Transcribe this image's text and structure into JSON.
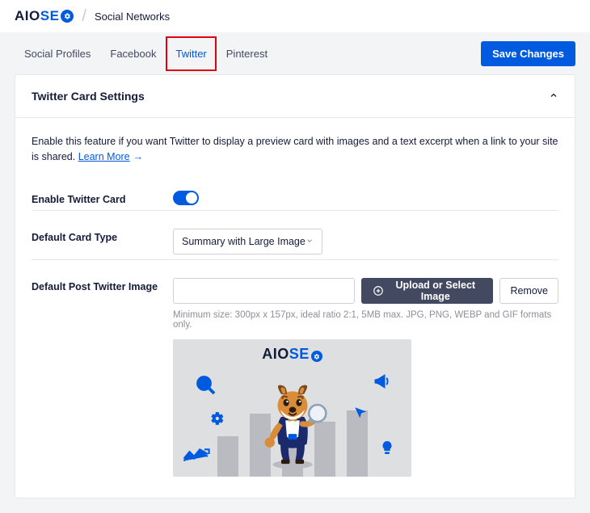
{
  "brand": {
    "text_left": "AIO",
    "text_right": "SE"
  },
  "header": {
    "page_title": "Social Networks"
  },
  "subnav": {
    "tabs": [
      {
        "label": "Social Profiles"
      },
      {
        "label": "Facebook"
      },
      {
        "label": "Twitter"
      },
      {
        "label": "Pinterest"
      }
    ],
    "save_button": "Save Changes"
  },
  "panel": {
    "title": "Twitter Card Settings",
    "intro_text": "Enable this feature if you want Twitter to display a preview card with images and a text excerpt when a link to your site is shared.",
    "learn_more": "Learn More",
    "rows": {
      "enable_card": {
        "label": "Enable Twitter Card",
        "value": true
      },
      "card_type": {
        "label": "Default Card Type",
        "selected": "Summary with Large Image"
      },
      "post_image": {
        "label": "Default Post Twitter Image",
        "input_value": "",
        "upload_btn": "Upload or Select Image",
        "remove_btn": "Remove",
        "hint": "Minimum size: 300px x 157px, ideal ratio 2:1, 5MB max. JPG, PNG, WEBP and GIF formats only."
      }
    }
  },
  "preview_brand": {
    "text_left": "AIO",
    "text_right": "SE"
  }
}
